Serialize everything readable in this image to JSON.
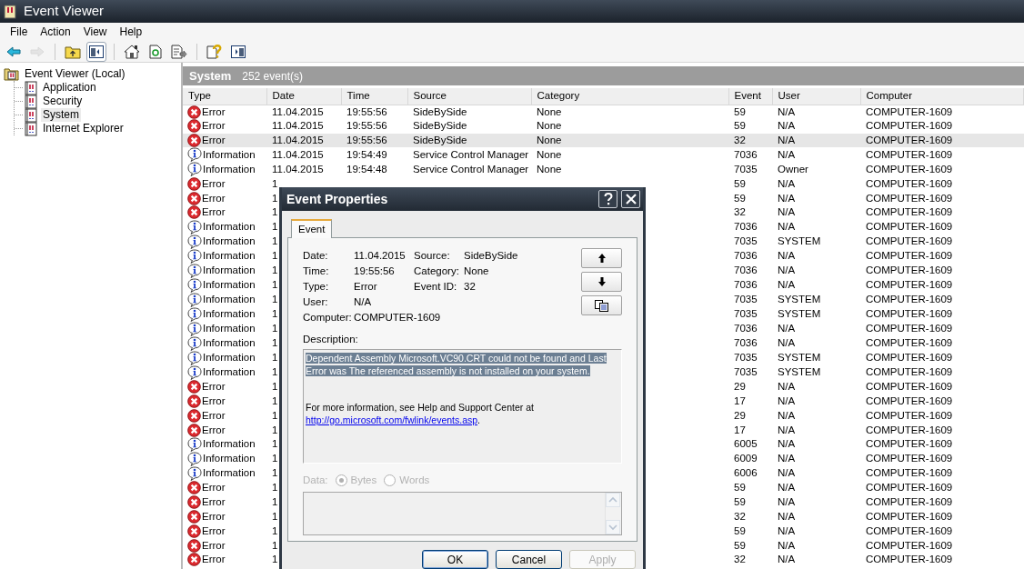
{
  "window": {
    "title": "Event Viewer"
  },
  "menu": [
    {
      "label": "File"
    },
    {
      "label": "Action"
    },
    {
      "label": "View"
    },
    {
      "label": "Help"
    }
  ],
  "toolbar_groups": [
    {
      "buttons": [
        {
          "kind": "back",
          "disabled": false,
          "pressed": false
        },
        {
          "kind": "forward",
          "disabled": true,
          "pressed": false
        }
      ]
    },
    {
      "buttons": [
        {
          "kind": "up",
          "disabled": false,
          "pressed": false
        },
        {
          "kind": "tree",
          "disabled": false,
          "pressed": true
        }
      ]
    },
    {
      "buttons": [
        {
          "kind": "properties",
          "disabled": false,
          "pressed": false
        },
        {
          "kind": "refresh",
          "disabled": false,
          "pressed": false
        },
        {
          "kind": "export",
          "disabled": false,
          "pressed": false
        }
      ]
    },
    {
      "buttons": [
        {
          "kind": "help",
          "disabled": false,
          "pressed": false
        },
        {
          "kind": "action",
          "disabled": false,
          "pressed": false
        }
      ]
    }
  ],
  "tree": {
    "label": "Event Viewer (Local)",
    "selected": false,
    "children": [
      {
        "label": "Application",
        "selected": false
      },
      {
        "label": "Security",
        "selected": false
      },
      {
        "label": "System",
        "selected": true
      },
      {
        "label": "Internet Explorer",
        "selected": false
      }
    ]
  },
  "panel": {
    "title": "System",
    "count": "252 event(s)"
  },
  "table": {
    "columns": [
      "Type",
      "Date",
      "Time",
      "Source",
      "Category",
      "Event",
      "User",
      "Computer"
    ],
    "rows": [
      {
        "kind": "error",
        "type": "Error",
        "date": "11.04.2015",
        "time": "19:55:56",
        "source": "SideBySide",
        "category": "None",
        "event": "59",
        "user": "N/A",
        "computer": "COMPUTER-1609",
        "selected": false
      },
      {
        "kind": "error",
        "type": "Error",
        "date": "11.04.2015",
        "time": "19:55:56",
        "source": "SideBySide",
        "category": "None",
        "event": "59",
        "user": "N/A",
        "computer": "COMPUTER-1609",
        "selected": false
      },
      {
        "kind": "error",
        "type": "Error",
        "date": "11.04.2015",
        "time": "19:55:56",
        "source": "SideBySide",
        "category": "None",
        "event": "32",
        "user": "N/A",
        "computer": "COMPUTER-1609",
        "selected": true
      },
      {
        "kind": "information",
        "type": "Information",
        "date": "11.04.2015",
        "time": "19:54:49",
        "source": "Service Control Manager",
        "category": "None",
        "event": "7036",
        "user": "N/A",
        "computer": "COMPUTER-1609",
        "selected": false
      },
      {
        "kind": "information",
        "type": "Information",
        "date": "11.04.2015",
        "time": "19:54:48",
        "source": "Service Control Manager",
        "category": "None",
        "event": "7035",
        "user": "Owner",
        "computer": "COMPUTER-1609",
        "selected": false
      },
      {
        "kind": "error",
        "type": "Error",
        "date": "1",
        "event": "59",
        "user": "N/A",
        "computer": "COMPUTER-1609",
        "selected": false
      },
      {
        "kind": "error",
        "type": "Error",
        "date": "1",
        "event": "59",
        "user": "N/A",
        "computer": "COMPUTER-1609",
        "selected": false
      },
      {
        "kind": "error",
        "type": "Error",
        "date": "1",
        "event": "32",
        "user": "N/A",
        "computer": "COMPUTER-1609",
        "selected": false
      },
      {
        "kind": "information",
        "type": "Information",
        "date": "1",
        "event": "7036",
        "user": "N/A",
        "computer": "COMPUTER-1609",
        "selected": false
      },
      {
        "kind": "information",
        "type": "Information",
        "date": "1",
        "event": "7035",
        "user": "SYSTEM",
        "computer": "COMPUTER-1609",
        "selected": false
      },
      {
        "kind": "information",
        "type": "Information",
        "date": "1",
        "event": "7036",
        "user": "N/A",
        "computer": "COMPUTER-1609",
        "selected": false
      },
      {
        "kind": "information",
        "type": "Information",
        "date": "1",
        "event": "7036",
        "user": "N/A",
        "computer": "COMPUTER-1609",
        "selected": false
      },
      {
        "kind": "information",
        "type": "Information",
        "date": "1",
        "event": "7036",
        "user": "N/A",
        "computer": "COMPUTER-1609",
        "selected": false
      },
      {
        "kind": "information",
        "type": "Information",
        "date": "1",
        "event": "7035",
        "user": "SYSTEM",
        "computer": "COMPUTER-1609",
        "selected": false
      },
      {
        "kind": "information",
        "type": "Information",
        "date": "1",
        "event": "7035",
        "user": "SYSTEM",
        "computer": "COMPUTER-1609",
        "selected": false
      },
      {
        "kind": "information",
        "type": "Information",
        "date": "1",
        "event": "7036",
        "user": "N/A",
        "computer": "COMPUTER-1609",
        "selected": false
      },
      {
        "kind": "information",
        "type": "Information",
        "date": "1",
        "event": "7036",
        "user": "N/A",
        "computer": "COMPUTER-1609",
        "selected": false
      },
      {
        "kind": "information",
        "type": "Information",
        "date": "1",
        "event": "7035",
        "user": "SYSTEM",
        "computer": "COMPUTER-1609",
        "selected": false
      },
      {
        "kind": "information",
        "type": "Information",
        "date": "1",
        "event": "7035",
        "user": "SYSTEM",
        "computer": "COMPUTER-1609",
        "selected": false
      },
      {
        "kind": "error",
        "type": "Error",
        "date": "1",
        "event": "29",
        "user": "N/A",
        "computer": "COMPUTER-1609",
        "selected": false
      },
      {
        "kind": "error",
        "type": "Error",
        "date": "1",
        "event": "17",
        "user": "N/A",
        "computer": "COMPUTER-1609",
        "selected": false
      },
      {
        "kind": "error",
        "type": "Error",
        "date": "1",
        "event": "29",
        "user": "N/A",
        "computer": "COMPUTER-1609",
        "selected": false
      },
      {
        "kind": "error",
        "type": "Error",
        "date": "1",
        "event": "17",
        "user": "N/A",
        "computer": "COMPUTER-1609",
        "selected": false
      },
      {
        "kind": "information",
        "type": "Information",
        "date": "1",
        "event": "6005",
        "user": "N/A",
        "computer": "COMPUTER-1609",
        "selected": false
      },
      {
        "kind": "information",
        "type": "Information",
        "date": "1",
        "event": "6009",
        "user": "N/A",
        "computer": "COMPUTER-1609",
        "selected": false
      },
      {
        "kind": "information",
        "type": "Information",
        "date": "1",
        "event": "6006",
        "user": "N/A",
        "computer": "COMPUTER-1609",
        "selected": false
      },
      {
        "kind": "error",
        "type": "Error",
        "date": "1",
        "event": "59",
        "user": "N/A",
        "computer": "COMPUTER-1609",
        "selected": false
      },
      {
        "kind": "error",
        "type": "Error",
        "date": "1",
        "event": "59",
        "user": "N/A",
        "computer": "COMPUTER-1609",
        "selected": false
      },
      {
        "kind": "error",
        "type": "Error",
        "date": "1",
        "event": "32",
        "user": "N/A",
        "computer": "COMPUTER-1609",
        "selected": false
      },
      {
        "kind": "error",
        "type": "Error",
        "date": "1",
        "event": "59",
        "user": "N/A",
        "computer": "COMPUTER-1609",
        "selected": false
      },
      {
        "kind": "error",
        "type": "Error",
        "date": "1",
        "event": "59",
        "user": "N/A",
        "computer": "COMPUTER-1609",
        "selected": false
      },
      {
        "kind": "error",
        "type": "Error",
        "date": "1",
        "event": "32",
        "user": "N/A",
        "computer": "COMPUTER-1609",
        "selected": false
      }
    ]
  },
  "dialog": {
    "title": "Event Properties",
    "tabs": [
      {
        "label": "Event",
        "selected": true
      }
    ],
    "fields_left": [
      {
        "label": "Date:",
        "value": "11.04.2015"
      },
      {
        "label": "Time:",
        "value": "19:55:56"
      },
      {
        "label": "Type:",
        "value": "Error"
      },
      {
        "label": "User:",
        "value": "N/A"
      },
      {
        "label": "Computer:",
        "value": "COMPUTER-1609"
      }
    ],
    "fields_right": [
      {
        "label": "Source:",
        "value": "SideBySide"
      },
      {
        "label": "Category:",
        "value": "None"
      },
      {
        "label": "Event ID:",
        "value": "32"
      }
    ],
    "nav_buttons": [
      {
        "kind": "up"
      },
      {
        "kind": "down"
      },
      {
        "kind": "copy"
      }
    ],
    "description_label": "Description:",
    "description": {
      "text": "Dependent Assembly Microsoft.VC90.CRT could not be found and Last Error was The referenced assembly is not installed on your system.",
      "highlighted": true,
      "more_info": "For more information, see Help and Support Center at",
      "link": "http://go.microsoft.com/fwlink/events.asp",
      "tail": "."
    },
    "data": {
      "label": "Data:",
      "disabled": true,
      "options": [
        {
          "label": "Bytes",
          "selected": true
        },
        {
          "label": "Words",
          "selected": false
        }
      ]
    },
    "buttons": [
      {
        "label": "OK",
        "default": true,
        "disabled": false
      },
      {
        "label": "Cancel",
        "default": false,
        "disabled": false
      },
      {
        "label": "Apply",
        "default": false,
        "disabled": true
      }
    ]
  }
}
